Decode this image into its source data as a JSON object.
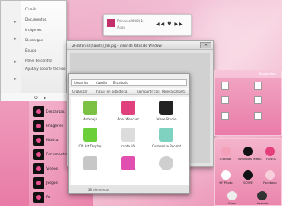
{
  "start_menu": {
    "items": [
      "Camila",
      "Documentos",
      "Imágenes",
      "Descargas",
      "Equipo",
      "Panel de control",
      "Ayuda y soporte técnico"
    ],
    "bottom": {
      "power_symbol": "⏻",
      "arrow": "▶"
    }
  },
  "app_list": [
    "Descargas",
    "Imágenes",
    "Música",
    "Documentos",
    "Vídeos",
    "Juegos",
    "Fx"
  ],
  "player": {
    "track": "Princess2000 (1)",
    "artist": "Akon",
    "controls": "◀◀ ♥ ▶▶"
  },
  "viewer": {
    "title": "ZFsnfan(sl)(Sandy)_(8).jpg - Visor de fotos de Window",
    "close": "✕"
  },
  "explorer": {
    "breadcrumb": [
      "Usuarios",
      "Camila",
      "Escritorio"
    ],
    "toolbar": [
      "Organizar",
      "Incluir en biblioteca",
      "Compartir con",
      "Nueva carpeta"
    ],
    "files": [
      {
        "name": "Antenaja",
        "color": "#7cc143"
      },
      {
        "name": "Acer Webcam",
        "color": "#e0407e"
      },
      {
        "name": "Wave Studio",
        "color": "#222222"
      },
      {
        "name": "CD Art Display",
        "color": "#6bcf3a"
      },
      {
        "name": "canta life",
        "color": "#dcdcdc"
      },
      {
        "name": "Customize Recent",
        "color": "#7fd1c0"
      },
      {
        "name": "",
        "color": "#c7c7c7"
      },
      {
        "name": "",
        "color": "#e14fb1"
      },
      {
        "name": "",
        "color": "#cfcfcf"
      }
    ],
    "status": "28 elementos"
  },
  "carpetas": {
    "title": "Carpetas"
  },
  "right_items": [
    "Outlook",
    "Windows Media",
    "ITUNES",
    "HP Photo",
    "SKYPE",
    "Facebook",
    "Glass",
    "Remote"
  ]
}
